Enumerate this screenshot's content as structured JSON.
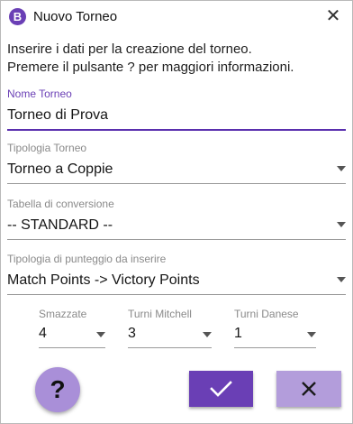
{
  "window": {
    "title": "Nuovo Torneo",
    "app_icon_letter": "B",
    "close_glyph": "✕"
  },
  "intro": {
    "line1": "Inserire i dati per la creazione del torneo.",
    "line2": "Premere il pulsante ? per maggiori informazioni."
  },
  "fields": {
    "nome_torneo": {
      "label": "Nome Torneo",
      "value": "Torneo di Prova"
    },
    "tipologia_torneo": {
      "label": "Tipologia Torneo",
      "value": "Torneo a Coppie"
    },
    "tabella_conversione": {
      "label": "Tabella di conversione",
      "value": "-- STANDARD --"
    },
    "tipologia_punteggio": {
      "label": "Tipologia di punteggio da inserire",
      "value": "Match Points -> Victory Points"
    }
  },
  "mini_fields": {
    "smazzate": {
      "label": "Smazzate",
      "value": "4"
    },
    "turni_mitchell": {
      "label": "Turni Mitchell",
      "value": "3"
    },
    "turni_danese": {
      "label": "Turni Danese",
      "value": "1"
    }
  },
  "buttons": {
    "help_label": "?",
    "confirm_icon": "check-icon",
    "cancel_icon": "close-icon"
  },
  "colors": {
    "accent": "#6a3fb5",
    "accent_light": "#b39ddb",
    "help_bg": "#a98fd8"
  }
}
